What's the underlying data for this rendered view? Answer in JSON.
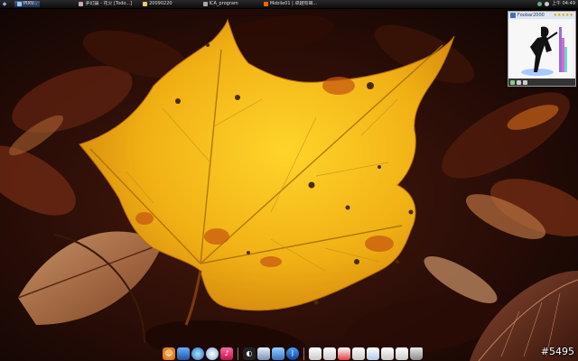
{
  "taskbar": {
    "start_icon": "windows-orb-icon",
    "tasks": [
      {
        "label": "PIXV...",
        "active": true,
        "icon": "app-icon",
        "color": "#8cf"
      },
      {
        "label": "夢幻論 - 花火 [Todo...]",
        "active": false,
        "icon": "app-icon",
        "color": "#caa"
      },
      {
        "label": "20090220",
        "active": false,
        "icon": "folder-icon",
        "color": "#ec6"
      },
      {
        "label": "ICA_program",
        "active": false,
        "icon": "app-icon",
        "color": "#aaa"
      },
      {
        "label": "Mobile01 | 卓越有聲...",
        "active": false,
        "icon": "browser-icon",
        "color": "#f60"
      }
    ],
    "clock": "上午 04:49"
  },
  "widget": {
    "title": "Foobar2000",
    "rating": "★★★★★"
  },
  "dock": {
    "left_icons": [
      "finder-icon",
      "monitor-icon",
      "globe-icon",
      "safari-icon",
      "music-icon",
      "pacman-icon",
      "photo-icon",
      "network-icon",
      "bluetooth-icon"
    ],
    "right_icons": [
      "doc-icon",
      "doc-icon",
      "pdf-icon",
      "doc-icon",
      "doc-icon",
      "doc-icon",
      "doc-icon",
      "trash-icon"
    ]
  },
  "watermark": "#5495"
}
